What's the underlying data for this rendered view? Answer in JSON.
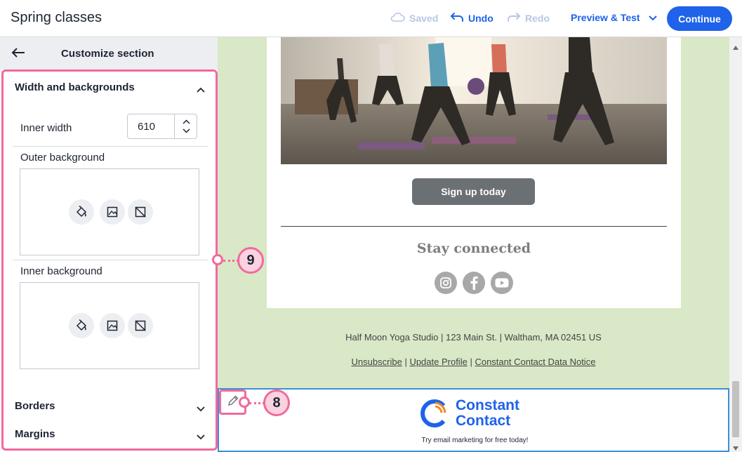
{
  "header": {
    "title": "Spring classes",
    "saved_label": "Saved",
    "undo_label": "Undo",
    "redo_label": "Redo",
    "preview_label": "Preview & Test",
    "continue_label": "Continue"
  },
  "sidebar": {
    "title": "Customize section",
    "sections": {
      "width_backgrounds": "Width and backgrounds",
      "borders": "Borders",
      "margins": "Margins"
    },
    "inner_width_label": "Inner width",
    "inner_width_value": "610",
    "outer_background_label": "Outer background",
    "inner_background_label": "Inner background"
  },
  "email": {
    "button_label": "Sign up today",
    "stay_connected": "Stay connected",
    "address": "Half Moon Yoga Studio | 123 Main St. | Waltham, MA 02451 US",
    "links": [
      "Unsubscribe",
      "Update Profile",
      "Constant Contact Data Notice"
    ],
    "brand_line1": "Constant",
    "brand_line2": "Contact",
    "tagline": "Try email marketing for free today!"
  },
  "callouts": {
    "sidebar": "9",
    "edit": "8"
  },
  "icons": [
    "cloud-icon",
    "undo-icon",
    "redo-icon",
    "chevron-down-icon",
    "back-arrow-icon",
    "chevron-up-icon",
    "paint-bucket-icon",
    "image-icon",
    "no-image-icon",
    "instagram-icon",
    "facebook-icon",
    "youtube-icon",
    "pencil-icon"
  ],
  "colors": {
    "accent": "#1e63e9",
    "highlight": "#f06a9e",
    "canvas_bg": "#d9e8c6",
    "button_gray": "#6b7075"
  }
}
